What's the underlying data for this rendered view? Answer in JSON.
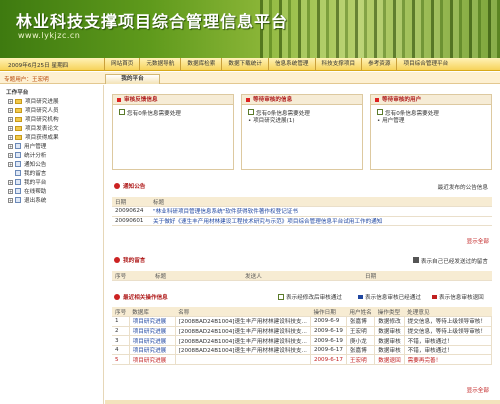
{
  "header": {
    "title": "林业科技支撑项目综合管理信息平台",
    "url": "www.lykjzc.cn"
  },
  "navbar": {
    "date": "2009年6月25日 星期四",
    "items": [
      "网站首页",
      "元数据导航",
      "数据库检索",
      "数据下载统计",
      "信息系统管理",
      "科技支撑项目",
      "参考资源",
      "项目综合管理平台"
    ]
  },
  "user": {
    "label": "专题用户：",
    "name": "王宏明"
  },
  "tab": "我的平台",
  "sidebar": {
    "title": "工作平台",
    "items": [
      "项目研究进展",
      "项目研究人员",
      "项目研究机构",
      "项目发表论文",
      "项目获得成果",
      "用户管理",
      "统计分析",
      "通知公告",
      "我的留言",
      "我的平台",
      "在线帮助",
      "退出系统"
    ]
  },
  "panels": [
    {
      "title": "审核反馈信息",
      "lines": [
        "您有0条信息需要处理"
      ]
    },
    {
      "title": "等待审核的信息",
      "lines": [
        "您有0条信息需要处理",
        "项目研究进展(1)"
      ]
    },
    {
      "title": "等待审核的用户",
      "lines": [
        "您有0条信息需要处理",
        "用户管理"
      ]
    }
  ],
  "notices": {
    "title": "通知公告",
    "right": "最近发布的公告信息",
    "headers": [
      "日期",
      "标题"
    ],
    "rows": [
      [
        "20090624",
        "\"林业科研项目管理信息系统\"软件获得软件著作权登记证书"
      ],
      [
        "20090601",
        "关于做好《速生丰产用材林建设工程技术研究与示范》项目综合管理信息平台试用工作的通知"
      ]
    ],
    "more": "显示全部"
  },
  "messages": {
    "title": "我的留言",
    "right": "表示自己已经发送过的留言",
    "headers": [
      "序号",
      "标题",
      "发送人",
      "日期"
    ]
  },
  "audit": {
    "title": "最近相关操作信息",
    "legend": [
      "表示经修改后审核通过",
      "表示信息审核已经通过",
      "表示信息审核退回"
    ],
    "legend_colors": [
      "#4a8a1e",
      "#1f46a0",
      "#c02020"
    ],
    "headers": [
      "序号",
      "数据库",
      "名称",
      "操作日期",
      "用户姓名",
      "操作类型",
      "处理意见"
    ],
    "rows": [
      [
        "1",
        "项目研究进展",
        "[2008BAD24B1004]速生丰产用材林建设科技支...",
        "2009-6-9",
        "张嘉博",
        "数据修改",
        "提交信息，等待上级领导审核！"
      ],
      [
        "2",
        "项目研究进展",
        "[2008BAD24B1004]速生丰产用材林建设科技支...",
        "2009-6-19",
        "王宏明",
        "数据审核",
        "提交信息，等待上级领导审核！"
      ],
      [
        "3",
        "项目研究进展",
        "[2008BAD24B1004]速生丰产用材林建设科技支...",
        "2009-6-19",
        "庚小龙",
        "数据审核",
        "不错，审核通过！"
      ],
      [
        "4",
        "项目研究进展",
        "[2008BAD24B1004]速生丰产用材林建设科技支...",
        "2009-6-17",
        "张嘉博",
        "数据审核",
        "不错，审核通过！"
      ],
      [
        "5",
        "项目研究进展",
        "",
        "2009-6-17",
        "王宏明",
        "数据退回",
        "需要再完善！"
      ]
    ],
    "more": "显示全部"
  }
}
